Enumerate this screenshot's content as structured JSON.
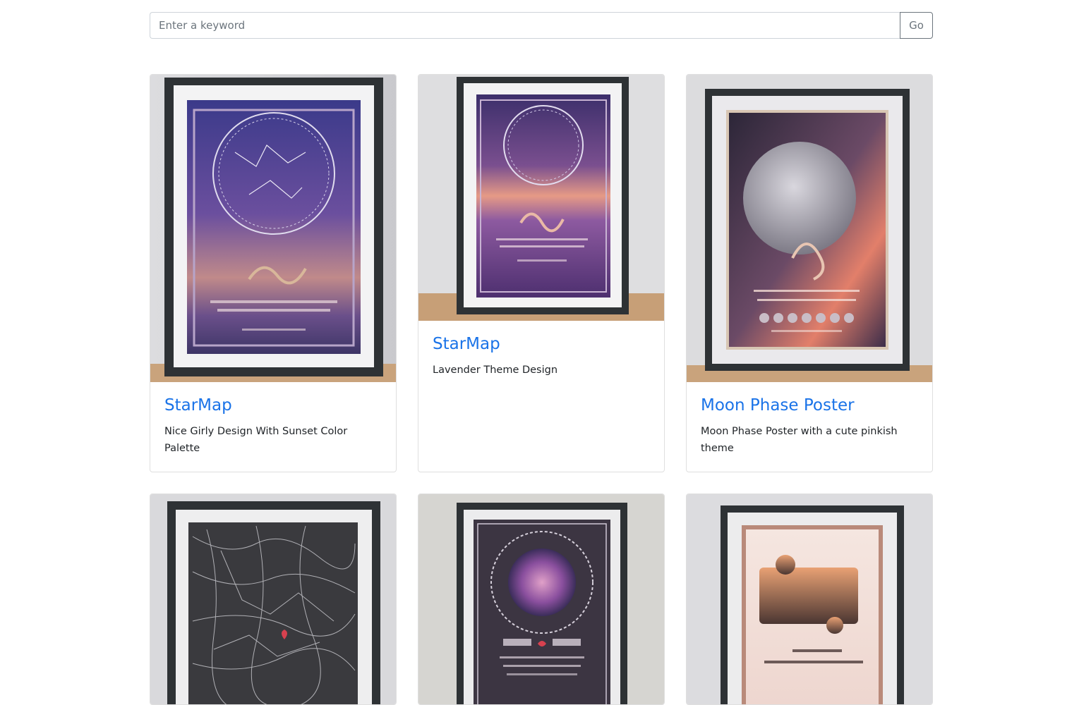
{
  "search": {
    "placeholder": "Enter a keyword",
    "value": "",
    "button_label": "Go"
  },
  "cards": [
    {
      "title": "StarMap",
      "description": "Nice Girly Design With Sunset Color Palette",
      "theme": "night-sky"
    },
    {
      "title": "StarMap",
      "description": "Lavender Theme Design",
      "theme": "lavender"
    },
    {
      "title": "Moon Phase Poster",
      "description": "Moon Phase Poster with a cute pinkish theme",
      "theme": "moon"
    },
    {
      "title": "",
      "description": "",
      "theme": "city-map"
    },
    {
      "title": "",
      "description": "",
      "theme": "galaxy-ornament"
    },
    {
      "title": "",
      "description": "",
      "theme": "puzzle"
    }
  ],
  "colors": {
    "link": "#1a73e8",
    "frame": "#2f3336",
    "wall": "#e6e6e8",
    "floor": "#c9a37c"
  }
}
